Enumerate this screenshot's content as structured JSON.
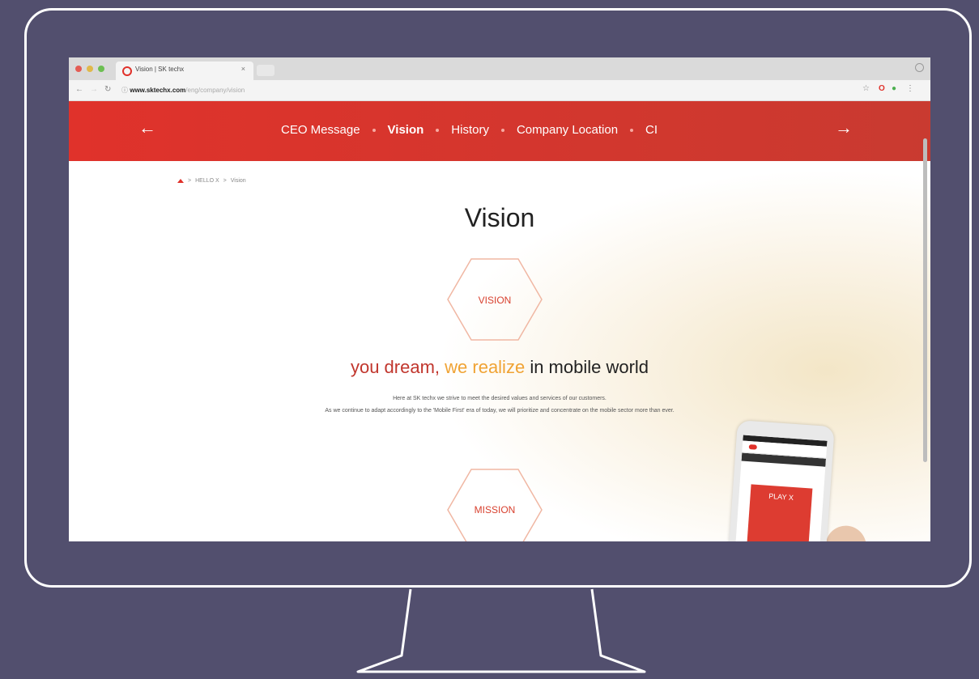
{
  "browser": {
    "tab_title": "Vision | SK techx",
    "tab_close": "×",
    "url_domain": "www.sktechx.com",
    "url_path": "/eng/company/vision"
  },
  "nav": {
    "prev_icon": "←",
    "next_icon": "→",
    "links": [
      "CEO Message",
      "Vision",
      "History",
      "Company Location",
      "CI"
    ],
    "active": "Vision"
  },
  "breadcrumb": [
    "HELLO X",
    "Vision"
  ],
  "page": {
    "title": "Vision",
    "vision_label": "VISION",
    "mission_label": "MISSION",
    "tagline_part1": "you dream,",
    "tagline_part2": "we realize",
    "tagline_part3": "in mobile world",
    "desc_line1": "Here at SK techx we strive to meet the desired values and services of our customers.",
    "desc_line2": "As we continue to adapt accordingly to the 'Mobile First' era of today, we will prioritize and concentrate on the mobile sector more than ever."
  },
  "phone": {
    "banner_title": "PLAY X"
  },
  "colors": {
    "brand_red": "#e0322b",
    "accent_orange": "#f0a334",
    "background": "#524f6e"
  }
}
